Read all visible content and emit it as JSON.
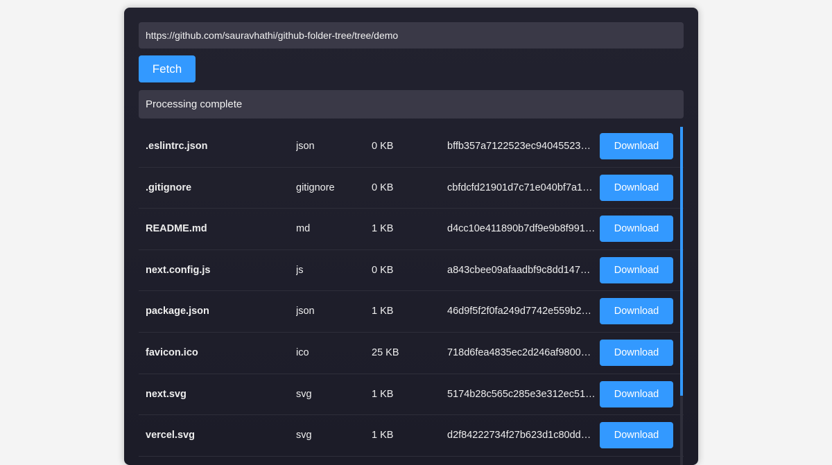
{
  "url_input": {
    "value": "https://github.com/sauravhathi/github-folder-tree/tree/demo"
  },
  "fetch_button": {
    "label": "Fetch"
  },
  "status": {
    "text": "Processing complete"
  },
  "files": [
    {
      "name": ".eslintrc.json",
      "type": "json",
      "size": "0 KB",
      "sha": "bffb357a7122523ec940455237…",
      "action": "Download"
    },
    {
      "name": ".gitignore",
      "type": "gitignore",
      "size": "0 KB",
      "sha": "cbfdcfd21901d7c71e040bf7a1…",
      "action": "Download"
    },
    {
      "name": "README.md",
      "type": "md",
      "size": "1 KB",
      "sha": "d4cc10e411890b7df9e9b8f991…",
      "action": "Download"
    },
    {
      "name": "next.config.js",
      "type": "js",
      "size": "0 KB",
      "sha": "a843cbee09afaadbf9c8dd1477…",
      "action": "Download"
    },
    {
      "name": "package.json",
      "type": "json",
      "size": "1 KB",
      "sha": "46d9f5f2f0fa249d7742e559b2c…",
      "action": "Download"
    },
    {
      "name": "favicon.ico",
      "type": "ico",
      "size": "25 KB",
      "sha": "718d6fea4835ec2d246af9800e…",
      "action": "Download"
    },
    {
      "name": "next.svg",
      "type": "svg",
      "size": "1 KB",
      "sha": "5174b28c565c285e3e312ec51…",
      "action": "Download"
    },
    {
      "name": "vercel.svg",
      "type": "svg",
      "size": "1 KB",
      "sha": "d2f84222734f27b623d1c80dda…",
      "action": "Download"
    }
  ],
  "colors": {
    "accent": "#3399ff",
    "panel_bg": "#1f1f2b",
    "field_bg": "#3a3947",
    "page_bg": "#f4f4f4"
  }
}
